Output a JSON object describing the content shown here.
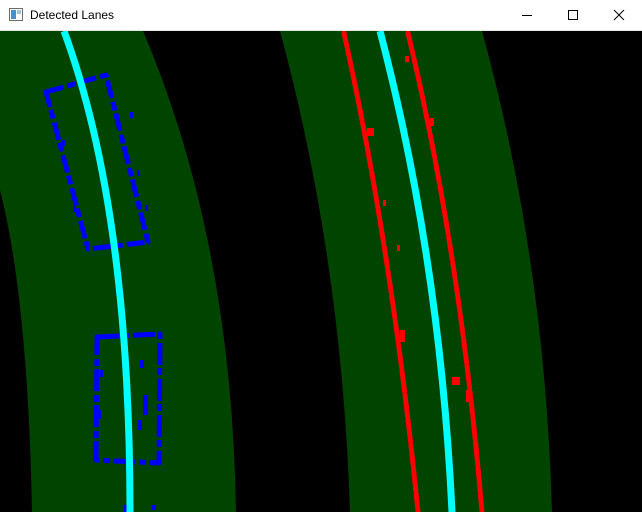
{
  "window": {
    "title": "Detected Lanes",
    "controls": {
      "minimize": "minimize-icon",
      "maximize": "maximize-icon",
      "close": "close-icon"
    }
  },
  "image": {
    "lane_fill_color": "#004400",
    "left_pixels_color": "#0000ff",
    "right_pixels_color": "#ff0000",
    "fit_line_color": "#00ffff",
    "background_color": "#000000"
  }
}
